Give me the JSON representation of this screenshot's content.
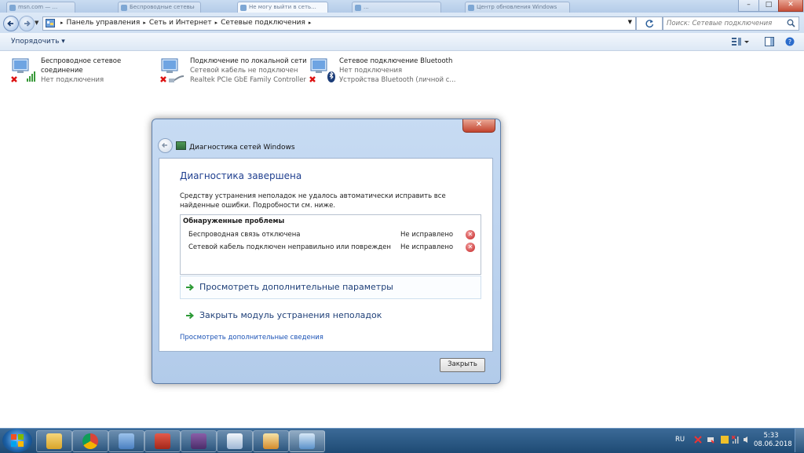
{
  "window": {
    "tabs": [
      {
        "label": "msn.com — ..."
      },
      {
        "label": "Беспроводные сетевые..."
      },
      {
        "label": "Не могу выйти в сеть..."
      },
      {
        "label": "..."
      },
      {
        "label": "Центр обновления Windows"
      }
    ],
    "controls": {
      "minimize": "–",
      "maximize": "□",
      "close": "✕"
    }
  },
  "address": {
    "crumbs": [
      "Панель управления",
      "Сеть и Интернет",
      "Сетевые подключения"
    ],
    "search_placeholder": "Поиск: Сетевые подключения"
  },
  "toolbar": {
    "organize_label": "Упорядочить ▾"
  },
  "connections": [
    {
      "name": "Беспроводное сетевое",
      "name2": "соединение",
      "status": "Нет подключения",
      "device": "",
      "icon": "wireless-network-icon",
      "badge": "red-x-icon"
    },
    {
      "name": "Подключение по локальной сети",
      "name2": "",
      "status": "Сетевой кабель не подключен",
      "device": "Realtek PCIe GbE Family Controller",
      "icon": "lan-network-icon",
      "badge": "red-x-icon"
    },
    {
      "name": "Сетевое подключение Bluetooth",
      "name2": "",
      "status": "Нет подключения",
      "device": "Устройства Bluetooth (личной с...",
      "icon": "bluetooth-network-icon",
      "badge": "red-x-icon"
    }
  ],
  "dialog": {
    "title": "Диагностика сетей Windows",
    "heading": "Диагностика завершена",
    "description": "Средству устранения неполадок не удалось автоматически исправить все найденные ошибки. Подробности см. ниже.",
    "problems_header": "Обнаруженные проблемы",
    "problems": [
      {
        "text": "Беспроводная связь отключена",
        "status": "Не исправлено"
      },
      {
        "text": "Сетевой кабель подключен неправильно или поврежден",
        "status": "Не исправлено"
      }
    ],
    "tasks": [
      {
        "label": "Просмотреть дополнительные параметры"
      },
      {
        "label": "Закрыть модуль устранения неполадок"
      }
    ],
    "more_link": "Просмотреть дополнительные сведения",
    "close_button": "Закрыть"
  },
  "taskbar": {
    "apps": [
      "explorer-icon",
      "chrome-icon",
      "control-panel-icon",
      "toolbox-icon",
      "archive-icon",
      "document-icon",
      "paint-icon",
      "network-diagnostics-icon"
    ],
    "lang": "RU",
    "time": "5:33",
    "date": "08.06.2018"
  },
  "colors": {
    "accent": "#1f3f8f",
    "link": "#1b53b6",
    "error": "#c22020",
    "taskbar": "#1e4a74"
  }
}
